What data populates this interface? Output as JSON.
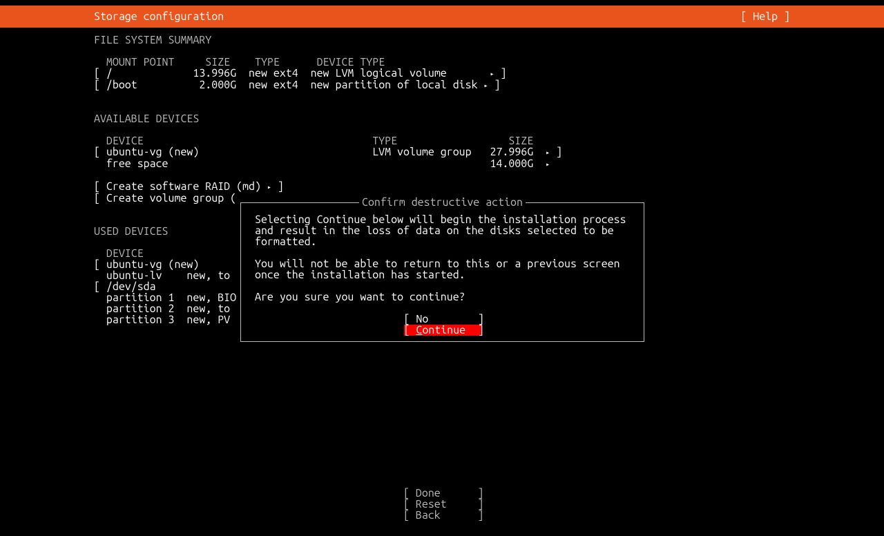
{
  "title": "Storage configuration",
  "help": "[ Help ]",
  "sections": {
    "fs_summary": "FILE SYSTEM SUMMARY",
    "available": "AVAILABLE DEVICES",
    "used": "USED DEVICES"
  },
  "fs_summary": {
    "header": {
      "mount": "MOUNT POINT",
      "size": "SIZE",
      "type": "TYPE",
      "devtype": "DEVICE TYPE"
    },
    "rows": [
      {
        "mount": "/",
        "size": "13.996G",
        "type": "new ext4",
        "devtype": "new LVM logical volume"
      },
      {
        "mount": "/boot",
        "size": "2.000G",
        "type": "new ext4",
        "devtype": "new partition of local disk"
      }
    ]
  },
  "available": {
    "header": {
      "device": "DEVICE",
      "type": "TYPE",
      "size": "SIZE"
    },
    "rows": [
      {
        "device": "ubuntu-vg (new)",
        "type": "LVM volume group",
        "size": "27.996G",
        "arrow": true
      },
      {
        "device": "free space",
        "type": "",
        "size": "14.000G",
        "arrow": true,
        "indent": true
      }
    ],
    "create_raid": "[ Create software RAID (md) ▸ ]",
    "create_vg": "[ Create volume group ("
  },
  "used": {
    "header": {
      "device": "DEVICE"
    },
    "rows": [
      "[ ubuntu-vg (new)",
      "  ubuntu-lv    new, to",
      "",
      "[ /dev/sda",
      "  partition 1  new, BIO",
      "  partition 2  new, to",
      "  partition 3  new, PV"
    ]
  },
  "dialog": {
    "title": "Confirm destructive action",
    "p1": "Selecting Continue below will begin the installation process and result in the loss of data on the disks selected to be formatted.",
    "p2": "You will not be able to return to this or a previous screen once the installation has started.",
    "p3": "Are you sure you want to continue?",
    "no": "No",
    "continue": "Continue"
  },
  "footer": {
    "done": "Done",
    "reset": "Reset",
    "back": "Back"
  }
}
